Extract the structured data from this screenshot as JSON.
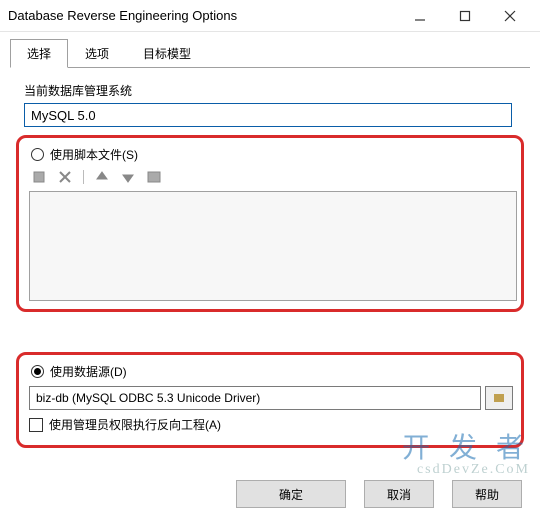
{
  "window": {
    "title": "Database Reverse Engineering Options"
  },
  "tabs": {
    "items": [
      {
        "label": "选择",
        "active": true
      },
      {
        "label": "选项",
        "active": false
      },
      {
        "label": "目标模型",
        "active": false
      }
    ]
  },
  "dbms": {
    "label": "当前数据库管理系统",
    "value": "MySQL 5.0"
  },
  "scriptOption": {
    "label": "使用脚本文件(S)",
    "checked": false,
    "icons": [
      "add-file-icon",
      "remove-icon",
      "move-up-icon",
      "move-down-icon",
      "list-icon"
    ]
  },
  "dataSourceOption": {
    "label": "使用数据源(D)",
    "checked": true,
    "value": "biz-db (MySQL ODBC 5.3 Unicode Driver)"
  },
  "adminCheckbox": {
    "label": "使用管理员权限执行反向工程(A)",
    "checked": false
  },
  "buttons": {
    "ok": "确定",
    "cancel": "取消",
    "help": "帮助"
  },
  "watermark": {
    "main": "开 发 者",
    "sub": "csdDevZe.CoM"
  }
}
